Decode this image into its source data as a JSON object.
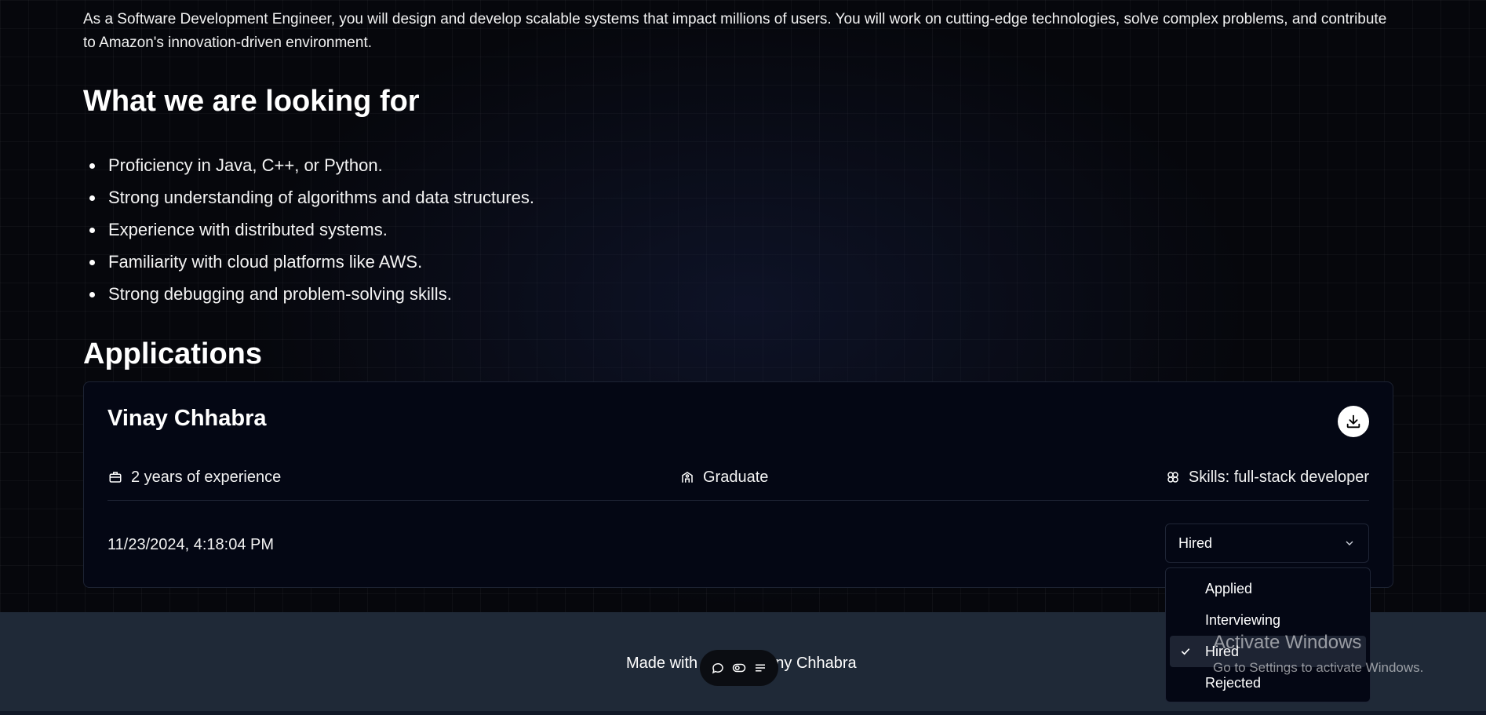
{
  "job": {
    "description": "As a Software Development Engineer, you will design and develop scalable systems that impact millions of users. You will work on cutting-edge technologies, solve complex problems, and contribute to Amazon's innovation-driven environment.",
    "requirements_heading": "What we are looking for",
    "requirements": [
      "Proficiency in Java, C++, or Python.",
      "Strong understanding of algorithms and data structures.",
      "Experience with distributed systems.",
      "Familiarity with cloud platforms like AWS.",
      "Strong debugging and problem-solving skills."
    ]
  },
  "applications": {
    "heading": "Applications",
    "items": [
      {
        "name": "Vinay Chhabra",
        "experience": "2 years of experience",
        "education": "Graduate",
        "skills": "Skills: full-stack developer",
        "applied_at": "11/23/2024, 4:18:04 PM",
        "status": "Hired",
        "icons": {
          "download": "download-icon",
          "experience": "briefcase-icon",
          "education": "school-icon",
          "skills": "brain-icon"
        }
      }
    ]
  },
  "status_dropdown": {
    "options": [
      "Applied",
      "Interviewing",
      "Hired",
      "Rejected"
    ],
    "selected": "Hired"
  },
  "footer": {
    "text_prefix": "Made with",
    "text_suffix": "ny Chhabra"
  },
  "overlay": {
    "watermark_title": "Activate Windows",
    "watermark_sub": "Go to Settings to activate Windows."
  },
  "colors": {
    "background": "#06070c",
    "card": "#040714",
    "footer": "#1f2937",
    "text": "#ffffff"
  }
}
